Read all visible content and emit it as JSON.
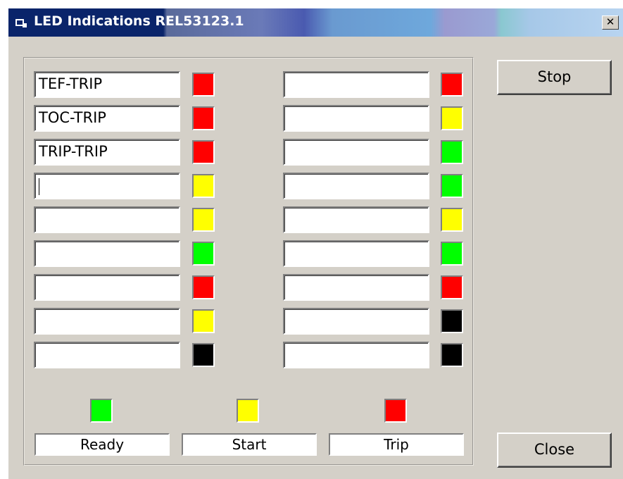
{
  "window": {
    "title": "LED Indications",
    "device": "REL53123.1",
    "close_glyph": "✕"
  },
  "colors": {
    "red": "#ff0000",
    "yellow": "#ffff00",
    "green": "#00ff00",
    "black": "#000000"
  },
  "left_rows": [
    {
      "text": "TEF-TRIP",
      "led": "red"
    },
    {
      "text": "TOC-TRIP",
      "led": "red"
    },
    {
      "text": "TRIP-TRIP",
      "led": "red"
    },
    {
      "text": "",
      "led": "yellow"
    },
    {
      "text": "",
      "led": "yellow"
    },
    {
      "text": "",
      "led": "green"
    },
    {
      "text": "",
      "led": "red"
    },
    {
      "text": "",
      "led": "yellow"
    },
    {
      "text": "",
      "led": "black"
    }
  ],
  "right_rows": [
    {
      "text": "",
      "led": "red"
    },
    {
      "text": "",
      "led": "yellow"
    },
    {
      "text": "",
      "led": "green"
    },
    {
      "text": "",
      "led": "green"
    },
    {
      "text": "",
      "led": "yellow"
    },
    {
      "text": "",
      "led": "green"
    },
    {
      "text": "",
      "led": "red"
    },
    {
      "text": "",
      "led": "black"
    },
    {
      "text": "",
      "led": "black"
    }
  ],
  "status": [
    {
      "label": "Ready",
      "led": "green"
    },
    {
      "label": "Start",
      "led": "yellow"
    },
    {
      "label": "Trip",
      "led": "red"
    }
  ],
  "buttons": {
    "stop": "Stop",
    "close": "Close"
  }
}
